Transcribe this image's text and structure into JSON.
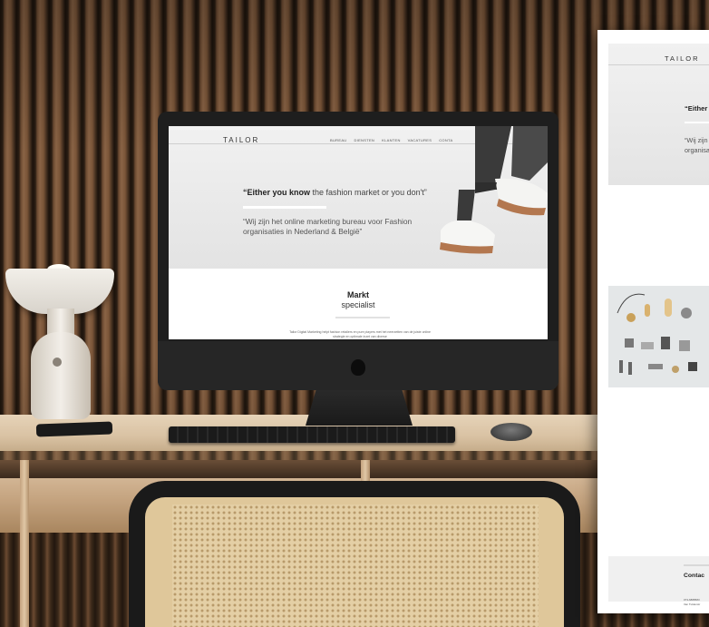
{
  "imac_screen": {
    "logo": "TAILOR",
    "nav": [
      "BUREAU",
      "DIENSTEN",
      "KLANTEN",
      "VACATURES",
      "CONTA"
    ],
    "quote_bold": "“Either you know",
    "quote_rest": " the fashion market or you don't”",
    "subtitle": "“Wij zijn het online marketing bureau voor Fashion organisaties in Nederland & België”",
    "section_title": "Markt",
    "section_subtitle": "specialist",
    "section_body": "Tailor Digital Marketing helpt fashion retailers en pure players met het neerzetten van de juiste online strategie en optimale inzet van diverse"
  },
  "page_mockup": {
    "logo": "TAILOR",
    "quote": "“Either",
    "subtitle_line1": "“Wij zijn",
    "subtitle_line2": "organisa",
    "contact_heading": "Contac",
    "contact_phone": "073-6888583",
    "contact_address": "Van Tuldenstr"
  },
  "colors": {
    "wall_wood": "#6b4a31",
    "desk": "#d9c2a3",
    "hero_gray": "#e3e3e3",
    "shoe_sole": "#b3774f"
  }
}
